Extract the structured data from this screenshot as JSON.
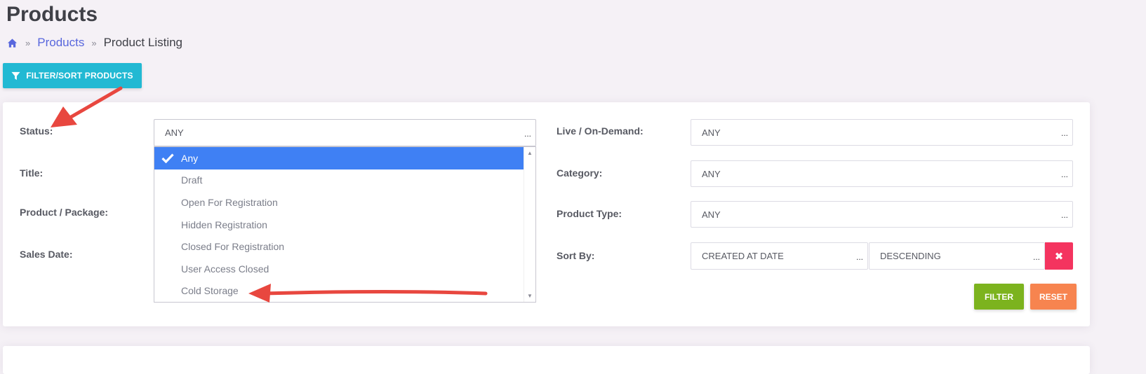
{
  "page": {
    "title": "Products"
  },
  "breadcrumb": {
    "separator": "»",
    "link": "Products",
    "current": "Product Listing"
  },
  "filter_toggle": {
    "label": "FILTER/SORT PRODUCTS",
    "icon": "filter-icon"
  },
  "filters": {
    "status": {
      "label": "Status:",
      "value": "ANY"
    },
    "title": {
      "label": "Title:"
    },
    "product_package": {
      "label": "Product / Package:"
    },
    "sales_date": {
      "label": "Sales Date:"
    },
    "live_on_demand": {
      "label": "Live / On-Demand:",
      "value": "ANY"
    },
    "category": {
      "label": "Category:",
      "value": "ANY"
    },
    "product_type": {
      "label": "Product Type:",
      "value": "ANY"
    },
    "sort_by": {
      "label": "Sort By:",
      "field": "CREATED AT DATE",
      "direction": "DESCENDING"
    },
    "dots": "..."
  },
  "status_dropdown": {
    "options": [
      "Any",
      "Draft",
      "Open For Registration",
      "Hidden Registration",
      "Closed For Registration",
      "User Access Closed",
      "Cold Storage"
    ],
    "selected": "Any"
  },
  "buttons": {
    "filter": "FILTER",
    "reset": "RESET",
    "clear": "✖"
  },
  "colors": {
    "accent": "#22b9d3",
    "selected_option": "#3f80f4",
    "filter_button": "#7cb31e",
    "reset_button": "#f7844f",
    "clear_button": "#f4345f",
    "annotation_arrow": "#e8473f",
    "link": "#5867dd"
  }
}
